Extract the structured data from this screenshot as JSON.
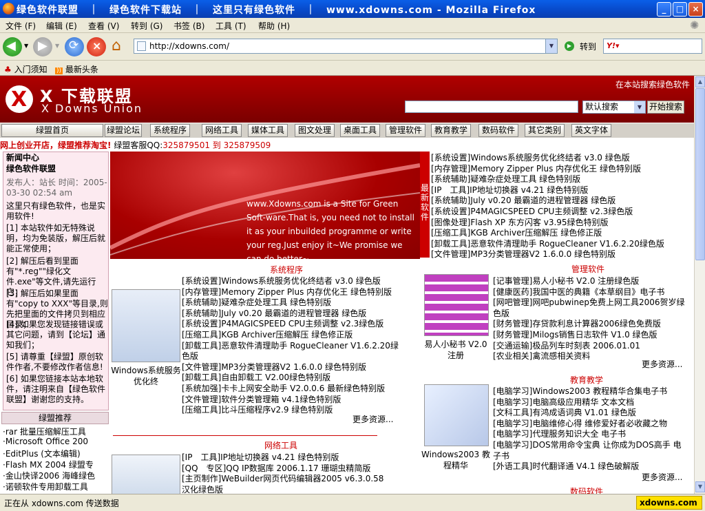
{
  "window": {
    "title": "绿色软件联盟　｜　绿色软件下载站　｜　这里只有绿色软件　｜　www.xdowns.com - Mozilla Firefox"
  },
  "menu": [
    "文件 (F)",
    "编辑 (E)",
    "查看 (V)",
    "转到 (G)",
    "书签 (B)",
    "工具 (T)",
    "帮助 (H)"
  ],
  "nav": {
    "url": "http://xdowns.com/",
    "go_label": "转到"
  },
  "bookmarks": [
    "入门须知",
    "最新头条"
  ],
  "site": {
    "search_label": "在本站搜索绿色软件",
    "search_option": "默认搜索",
    "search_button": "开始搜索",
    "logo_cn": "X 下载联盟",
    "logo_en": "X Downs Union",
    "tabs": [
      "绿盟首页",
      "绿盟论坛",
      "系统程序",
      "网络工具",
      "媒体工具",
      "图文处理",
      "桌面工具",
      "管理软件",
      "教育教学",
      "数码软件",
      "其它类别",
      "英文字体"
    ],
    "ad_red": "网上创业开店，绿盟推荐淘宝!",
    "ad_qq_label": "绿盟客服QQ:",
    "ad_qq": "325879501 到 325879509"
  },
  "news": {
    "title": "新闻中心",
    "subtitle": "绿色软件联盟",
    "meta": "发布人：站长 时间：2005-03-30 02:54 am",
    "body": [
      "这里只有绿色软件，也是实用软件!",
      "[1] 本站软件如无特殊说明，均为免装版，解压后就能正常使用；",
      "[2] 解压后看到里面有\"*.reg\"\"绿化文件.exe\"等文件,请先运行它；",
      "[3] 解压后如果里面有\"copy to XXX\"等目录,则先把里面的文件拷贝到相应目录；",
      "[4] 如果您发现链接错误或其它问题，请到【论坛】通知我们；",
      "[5] 请尊重【绿盟】原创软件作者,不要修改作者信息!",
      "[6] 如果您链接本站本地软件，请注明来自【绿色软件联盟】谢谢您的支持。"
    ]
  },
  "recommend": {
    "title": "绿盟推荐",
    "items": [
      "·rar 批量压缩解压工具",
      "·Microsoft Office 200",
      "·EditPlus (文本编辑)",
      "·Flash MX 2004 绿盟专",
      "·金山快译2006 海峰绿色",
      "·诺顿软件专用卸载工具"
    ]
  },
  "banner": {
    "text": "www.Xdowns.com is a Site for Green Soft-ware.That is, you need not to install it as your inbuilded programme or write your reg.Just enjoy it~We promise we can do better~"
  },
  "latest": {
    "label": "最新软件",
    "items": [
      "[系统设置]Windows系统服务优化终结者 v3.0 绿色版",
      "[内存管理]Memory Zipper Plus 内存优化王 绿色特别版",
      "[系统辅助]疑难杂症处理工具 绿色特别版",
      "[IP　工具]IP地址切换器 v4.21 绿色特别版",
      "[系统辅助]July v0.20 最霸道的进程管理器 绿色版",
      "[系统设置]P4MAGICSPEED CPU主频调整 v2.3绿色版",
      "[图像处理]Flash XP 东方闪客 v3.95绿色特别版",
      "[压缩工具]KGB Archiver压缩解压 绿色修正版",
      "[卸载工具]恶意软件清理助手 RogueCleaner V1.6.2.20绿色版",
      "[文件管理]MP3分类管理器V2 1.6.0.0 绿色特别版"
    ]
  },
  "sections": {
    "system": {
      "title": "系统程序",
      "caption": "Windows系统服务优化终",
      "more": "更多资源...",
      "items": [
        "[系统设置]Windows系统服务优化终结者 v3.0 绿色版",
        "[内存管理]Memory Zipper Plus 内存优化王 绿色特别版",
        "[系统辅助]疑难杂症处理工具 绿色特别版",
        "[系统辅助]July v0.20 最霸道的进程管理器 绿色版",
        "[系统设置]P4MAGICSPEED CPU主频调整 v2.3绿色版",
        "[压缩工具]KGB Archiver压缩解压 绿色修正版",
        "[卸载工具]恶意软件清理助手 RogueCleaner V1.6.2.20绿",
        "色版",
        "[文件管理]MP3分类管理器V2 1.6.0.0 绿色特别版",
        "[卸载工具]自由卸载工 V2.00绿色特别版",
        "[系统加强]卡卡上网安全助手 V2.0.0.6 最新绿色特别版",
        "[文件管理]软件分类管理箱 v4.1绿色特别版",
        "[压缩工具]比斗压缩程序v2.9 绿色特别版"
      ]
    },
    "network": {
      "title": "网络工具",
      "items": [
        "[IP　工具]IP地址切换器 v4.21 绿色特别版",
        "[QQ　专区]QQ IP数据库 2006.1.17 珊瑚虫精简版",
        "[主页制作]WeBuilder网页代码编辑器2005 v6.3.0.58",
        "汉化绿色版"
      ]
    },
    "mgmt": {
      "title": "管理软件",
      "caption": "易人小秘书 V2.0 注册",
      "more": "更多资源...",
      "items": [
        "[记事管理]易人小秘书 V2.0 注册绿色版",
        "[健康医药]我国中医的典籍《本草纲目》电子书",
        "[网吧管理]网吧pubwinep免费上网工具2006贺岁绿",
        "色版",
        "[财务管理]存贷款利息计算器2006绿色免费版",
        "[财务管理]Milogs销售日志软件 V1.0 绿色版",
        "[交通运输]极品列车时刻表 2006.01.01",
        "[农业相关]禽流感相关资料"
      ]
    },
    "edu": {
      "title": "教育教学",
      "caption": "Windows2003 教程精华",
      "more": "更多资源...",
      "items": [
        "[电脑学习]Windows2003 教程精华合集电子书",
        "[电脑学习]电脑高级应用精华 文本文档",
        "[文科工具]有鸿成语词典 V1.01 绿色版",
        "[电脑学习]电脑维修心得 维修爱好者必收藏之物",
        "[电脑学习]代理服务知识大全 电子书",
        "[电脑学习]DOS常用命令宝典 让你成为DOS高手 电",
        "子书",
        "[外语工具]时代翻译通 V4.1 绿色破解版"
      ]
    },
    "digital": {
      "title": "数码软件"
    }
  },
  "status": {
    "text": "正在从 xdowns.com 传送数据",
    "domain": "xdowns.com"
  }
}
